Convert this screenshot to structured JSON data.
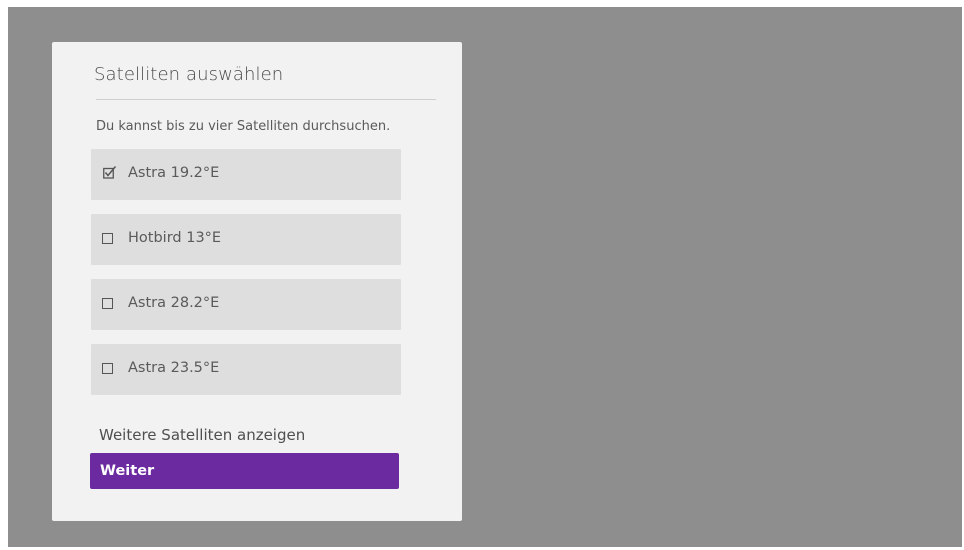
{
  "dialog": {
    "title": "Satelliten auswählen",
    "subtitle": "Du kannst bis zu vier Satelliten durchsuchen.",
    "options": [
      {
        "label": "Astra 19.2°E",
        "checked": true
      },
      {
        "label": "Hotbird 13°E",
        "checked": false
      },
      {
        "label": "Astra 28.2°E",
        "checked": false
      },
      {
        "label": "Astra 23.5°E",
        "checked": false
      }
    ],
    "more_link": "Weitere Satelliten anzeigen",
    "continue_label": "Weiter"
  },
  "colors": {
    "background": "#8e8e8e",
    "dialog": "#f2f2f2",
    "option": "#dedede",
    "accent": "#6c2aa1"
  }
}
